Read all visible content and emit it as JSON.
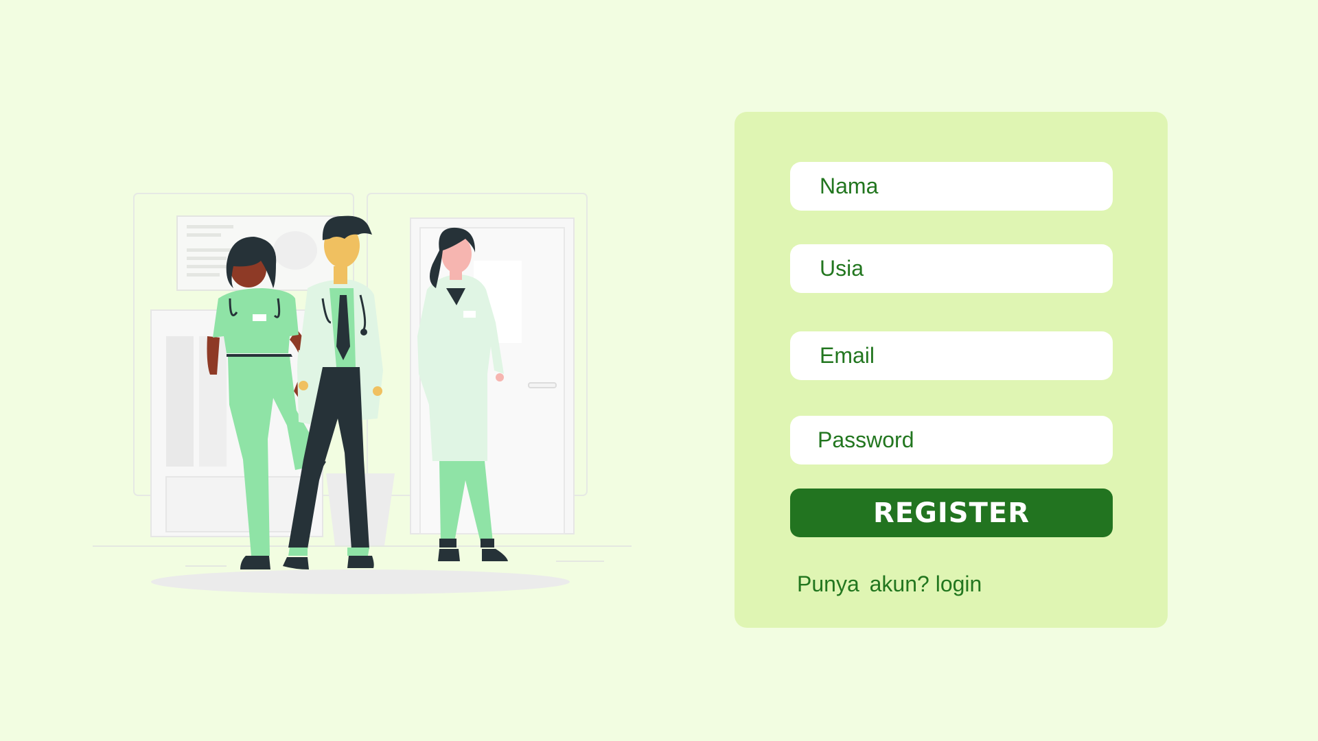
{
  "form": {
    "fields": {
      "nama": {
        "placeholder": "Nama",
        "value": ""
      },
      "usia": {
        "placeholder": "Usia",
        "value": ""
      },
      "email": {
        "placeholder": "Email",
        "value": ""
      },
      "password": {
        "placeholder": "Password",
        "value": ""
      }
    },
    "register_label": "REGISTER",
    "login_prompt": "Punya akun?",
    "login_link": "login"
  },
  "illustration": {
    "subject": "medical-staff-illustration"
  },
  "colors": {
    "background": "#f2fde1",
    "card": "#dff5b3",
    "accent": "#227420",
    "text": "#22761f",
    "scrubs": "#8fe3a6",
    "coat": "#e0f5e4"
  }
}
